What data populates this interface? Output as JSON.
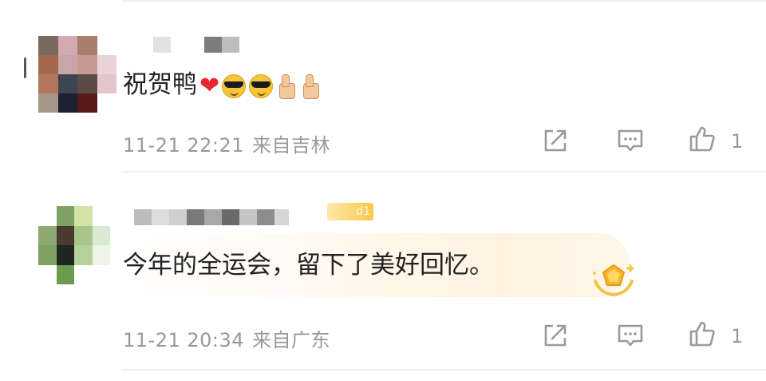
{
  "comments": [
    {
      "text": "祝贺鸭",
      "emoji": [
        "red-heart",
        "sunglasses-face",
        "sunglasses-face",
        "thumbs-up",
        "thumbs-up"
      ],
      "date": "11-21 22:21",
      "location": "来自吉林",
      "likes": "1"
    },
    {
      "text": "今年的全运会，留下了美好回忆。",
      "badge": "d1",
      "date": "11-21 20:34",
      "location": "来自广东",
      "likes": "1"
    }
  ],
  "colors": {
    "meta_gray": "#999999",
    "heart": "#e8262e",
    "badge_gold": "#f7c94a"
  },
  "icons": [
    "share-icon",
    "comment-icon",
    "like-icon",
    "medal-icon"
  ]
}
